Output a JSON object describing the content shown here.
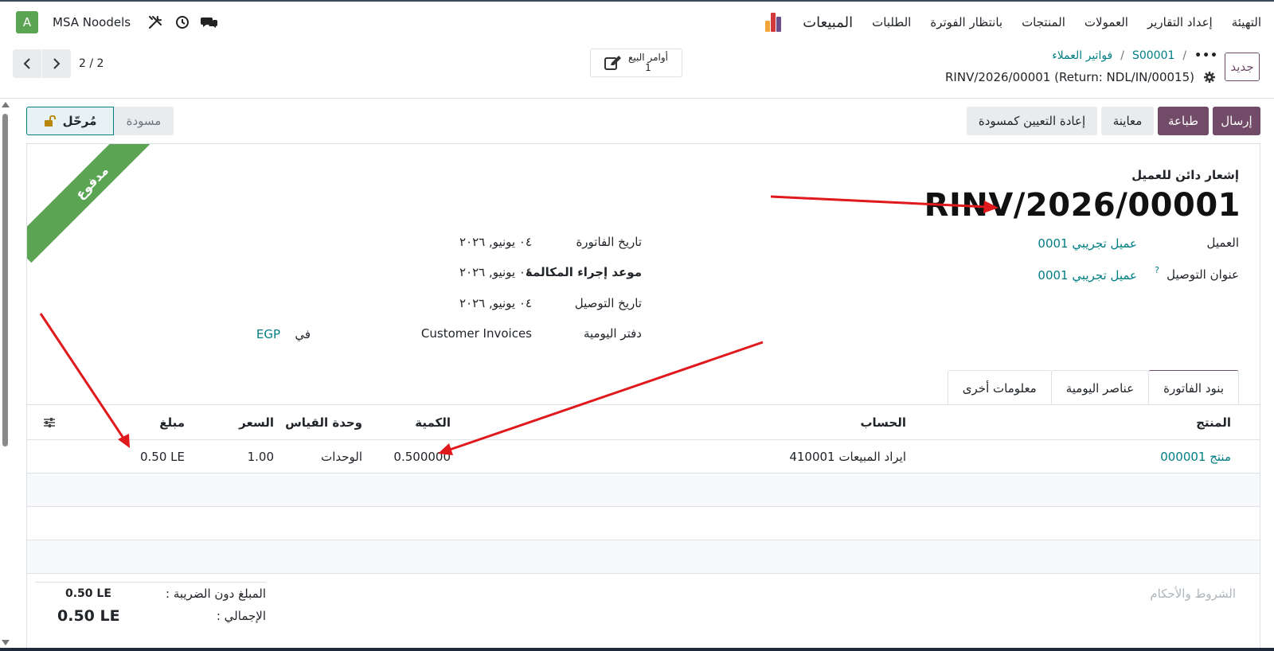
{
  "navbar": {
    "app_name": "المبيعات",
    "menu": [
      "الطلبات",
      "بانتظار الفوترة",
      "المنتجات",
      "العمولات",
      "إعداد التقارير",
      "التهيئة"
    ],
    "company": "MSA Noodels",
    "avatar_letter": "A"
  },
  "control_panel": {
    "new_label": "جديد",
    "breadcrumb": [
      "S00001",
      "فواتير العملاء"
    ],
    "breadcrumb_sep": "/",
    "record_title": "RINV/2026/00001 (Return: NDL/IN/00015)",
    "smart_button": {
      "label": "أوامر البيع",
      "count": "1"
    },
    "pager": "2 / 2"
  },
  "actions": {
    "send": "إرسال",
    "print": "طباعة",
    "preview": "معاينة",
    "reset": "إعادة التعيين كمسودة"
  },
  "status": {
    "current": "مُرحّل",
    "other": "مسودة"
  },
  "sheet": {
    "ribbon": "مدفوع",
    "move_type": "إشعار دائن للعميل",
    "name": "RINV/2026/00001",
    "customer_label": "العميل",
    "customer_value": "عميل تجريبي 0001",
    "delivery_label": "عنوان التوصيل",
    "delivery_help": "?",
    "delivery_value": "عميل تجريبي 0001",
    "invoice_date_label": "تاريخ الفاتورة",
    "invoice_date": "٠٤ يونيو, ٢٠٢٦",
    "due_date_label": "موعد إجراء المكالمة",
    "due_date": "٠٤ يونيو, ٢٠٢٦",
    "delivery_date_label": "تاريخ التوصيل",
    "delivery_date": "٠٤ يونيو, ٢٠٢٦",
    "journal_label": "دفتر اليومية",
    "journal_value": "Customer Invoices",
    "in_label": "في",
    "currency": "EGP"
  },
  "tabs": [
    "بنود الفاتورة",
    "عناصر اليومية",
    "معلومات أخرى"
  ],
  "table": {
    "headers": {
      "product": "المنتج",
      "account": "الحساب",
      "quantity": "الكمية",
      "uom": "وحدة القياس",
      "price": "السعر",
      "amount": "مبلغ"
    },
    "rows": [
      {
        "product": "منتج 000001",
        "account": "410001 ايراد المبيعات",
        "quantity": "0.500000",
        "uom": "الوحدات",
        "price": "1.00",
        "amount": "0.50 LE"
      }
    ]
  },
  "footer": {
    "terms": "الشروط والأحكام",
    "untaxed_label": "المبلغ دون الضريبة :",
    "untaxed_value": "0.50 LE",
    "total_label": "الإجمالي :",
    "total_value": "0.50 LE"
  },
  "colors": {
    "primary": "#714b67",
    "link": "#017e84",
    "ribbon": "#5aa453",
    "arrow": "#e0191c"
  }
}
